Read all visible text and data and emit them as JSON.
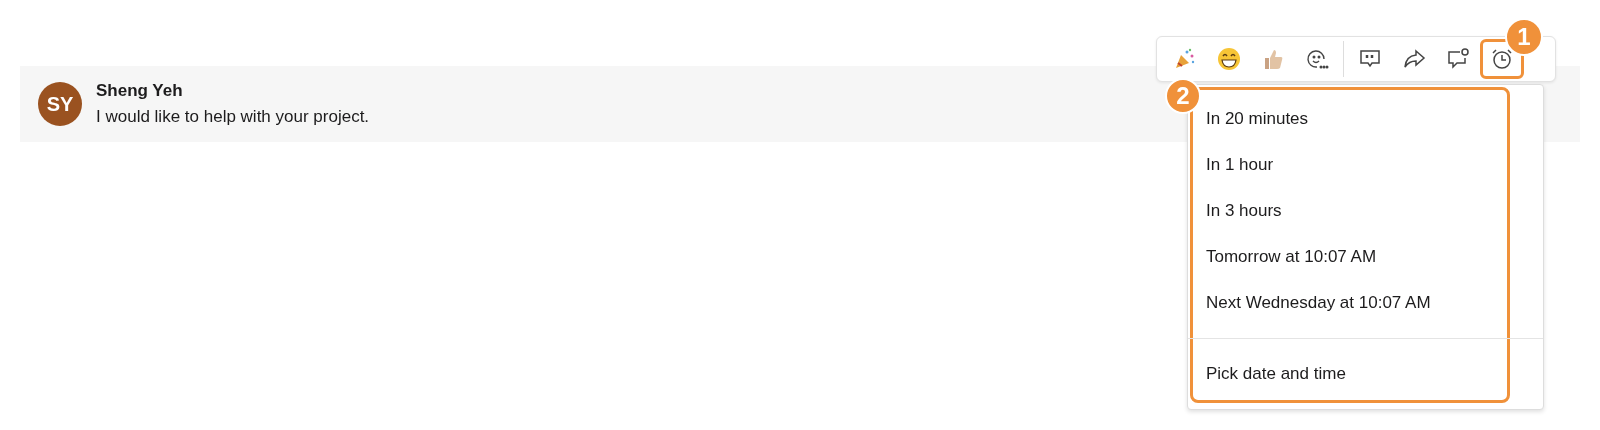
{
  "message": {
    "avatar_initials": "SY",
    "author": "Sheng Yeh",
    "text": "I would like to help with your project."
  },
  "toolbar": {
    "buttons": [
      {
        "kind": "party",
        "highlighted": false
      },
      {
        "kind": "grin",
        "highlighted": false
      },
      {
        "kind": "thumbs",
        "highlighted": false
      },
      {
        "kind": "add-reaction",
        "highlighted": false
      },
      {
        "kind": "quote",
        "highlighted": false
      },
      {
        "kind": "share",
        "highlighted": false
      },
      {
        "kind": "reply",
        "highlighted": false
      },
      {
        "kind": "alarm",
        "highlighted": true
      }
    ]
  },
  "remind_menu": {
    "highlighted": true,
    "items": [
      "In 20 minutes",
      "In 1 hour",
      "In 3 hours",
      "Tomorrow at 10:07 AM",
      "Next Wednesday at 10:07 AM"
    ],
    "footer_item": "Pick date and time"
  },
  "callouts": [
    {
      "label": "1",
      "kind": "toolbar"
    },
    {
      "label": "2",
      "kind": "menu"
    }
  ]
}
